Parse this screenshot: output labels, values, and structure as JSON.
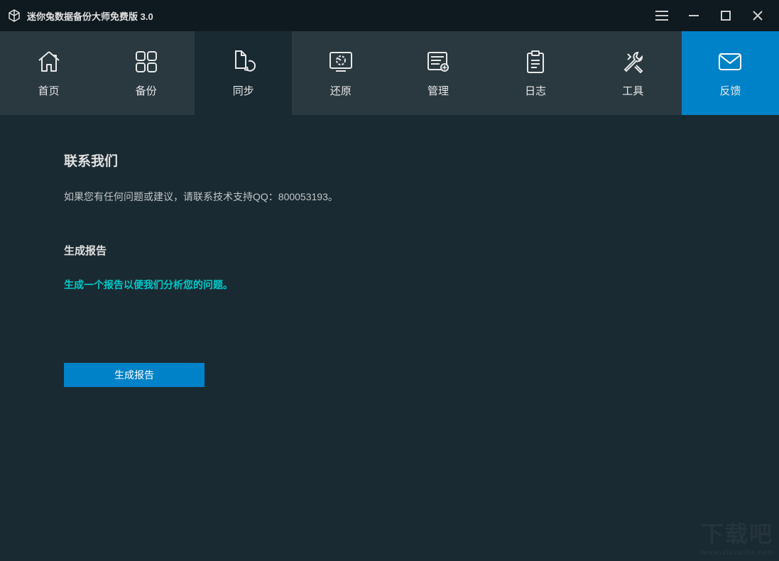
{
  "app": {
    "title": "迷你兔数据备份大师免费版 3.0"
  },
  "nav": {
    "tabs": [
      {
        "label": "首页",
        "icon": "home"
      },
      {
        "label": "备份",
        "icon": "grid"
      },
      {
        "label": "同步",
        "icon": "sync"
      },
      {
        "label": "还原",
        "icon": "restore"
      },
      {
        "label": "管理",
        "icon": "manage"
      },
      {
        "label": "日志",
        "icon": "log"
      },
      {
        "label": "工具",
        "icon": "tools"
      },
      {
        "label": "反馈",
        "icon": "mail"
      }
    ]
  },
  "content": {
    "heading_contact": "联系我们",
    "contact_desc": "如果您有任何问题或建议，请联系技术支持QQ：800053193。",
    "heading_report": "生成报告",
    "report_link": "生成一个报告以便我们分析您的问题。",
    "generate_button": "生成报告"
  },
  "watermark": {
    "main": "下载吧",
    "sub": "www.xiazaiba.com"
  }
}
